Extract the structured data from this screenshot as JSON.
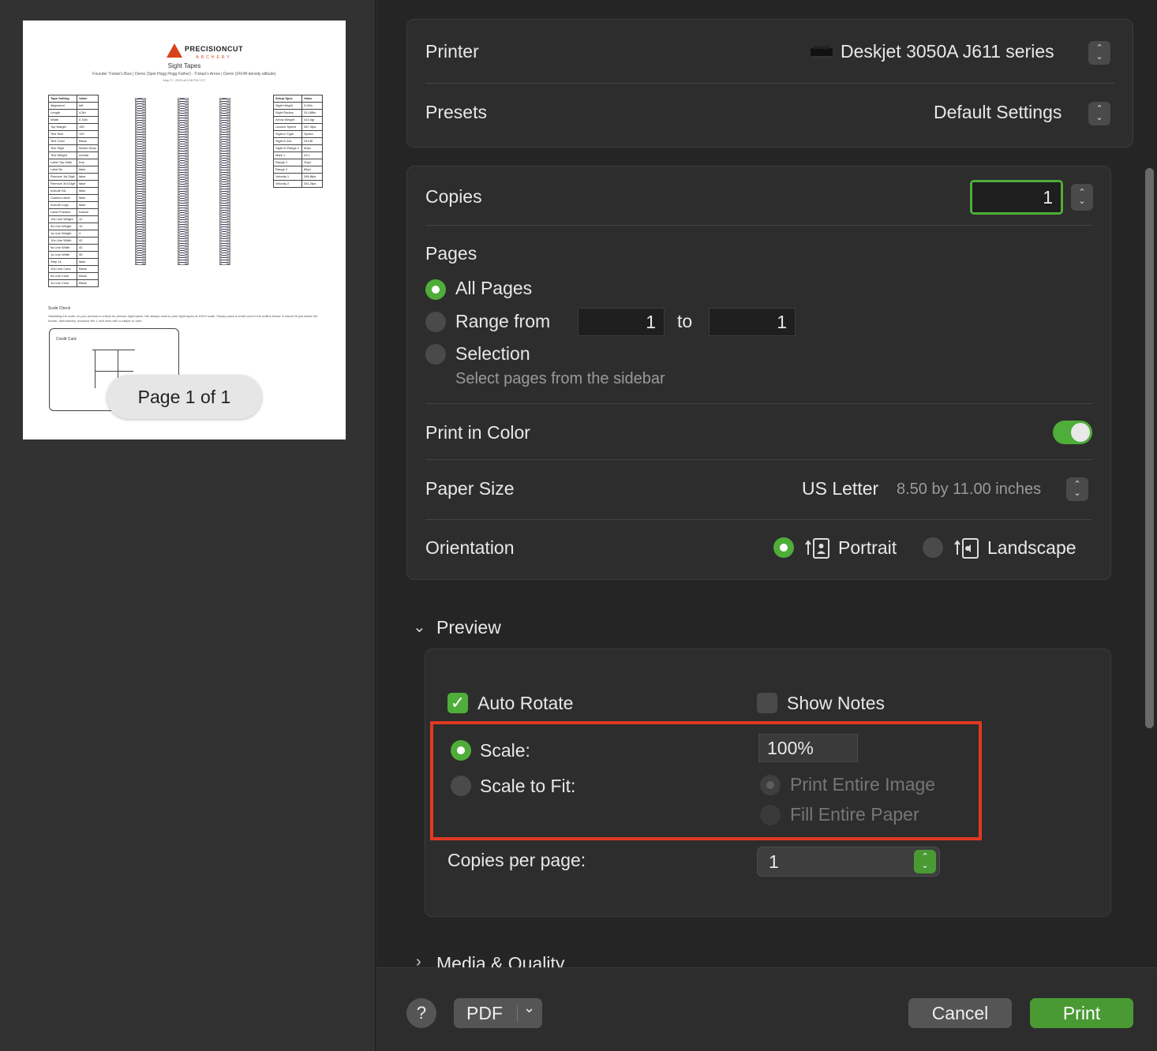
{
  "preview": {
    "logo_text": "PRECISIONCUT",
    "logo_sub": "ARCHERY",
    "doc_title": "Sight Tapes",
    "doc_subtitle": "Founder Tristan's Bow | Demo (Spot Hogg Hogg Father) - Tristan's Arrow | Demo (2414ft density altitude)",
    "doc_date": "May 27, 2025 at 8:38 PM CDT",
    "left_table": [
      [
        "Tape Setting",
        "Value"
      ],
      [
        "Alignment",
        "left"
      ],
      [
        "Length",
        "4.5in"
      ],
      [
        "Width",
        "0.15in"
      ],
      [
        "Top Margin",
        "150"
      ],
      [
        "Text Size",
        "120"
      ],
      [
        "Text Color",
        "Black"
      ],
      [
        "Text Style",
        "Nunito Sans"
      ],
      [
        "Text Weight",
        "normal"
      ],
      [
        "Label Top Mark",
        "true"
      ],
      [
        "Label 5s",
        "false"
      ],
      [
        "Remove 1st Digit",
        "false"
      ],
      [
        "Remove 3rd Digit",
        "false"
      ],
      [
        "Include DA",
        "false"
      ],
      [
        "Custom Label",
        "false"
      ],
      [
        "Include Logo",
        "false"
      ],
      [
        "Label Position",
        "bottom"
      ],
      [
        "10s Line Weight",
        "12"
      ],
      [
        "5s Line Weight",
        "10"
      ],
      [
        "1s Line Weight",
        "4"
      ],
      [
        "10s Line Width",
        "42"
      ],
      [
        "5s Line Width",
        "40"
      ],
      [
        "1s Line Width",
        "35"
      ],
      [
        "Step 1s",
        "false"
      ],
      [
        "10s Line Color",
        "Black"
      ],
      [
        "5s Line Color",
        "Black"
      ],
      [
        "1s Line Color",
        "Black"
      ]
    ],
    "right_table": [
      [
        "Setup Spec",
        "Value"
      ],
      [
        "Sight Height",
        "3.92in"
      ],
      [
        "Sight Radius",
        "25.188in"
      ],
      [
        "Arrow Weight",
        "413.4gr"
      ],
      [
        "Launch Speed",
        "287.4fps"
      ],
      [
        "Sight-in Type",
        "Speed"
      ],
      [
        "Sight-in DA",
        "2414ft"
      ],
      [
        "Sight-In Range 1",
        "60yd"
      ],
      [
        "Mark 1",
        "23.1"
      ],
      [
        "Range 1",
        "20yd"
      ],
      [
        "Range 2",
        "65yd"
      ],
      [
        "Velocity 1",
        "286.8fps"
      ],
      [
        "Velocity 2",
        "261.2fps"
      ]
    ],
    "scale_check_title": "Scale Check",
    "scale_check_text": "Validating the scale on your printout is critical for precise sight tapes. We always want to print sight tapes at 100% scale. Simply place a credit card in the outline below. It should fit just inside the border. Alternatively, measure the 1 inch lines with a caliper or ruler.",
    "card_label": "Credit Card",
    "page_indicator": "Page 1 of 1"
  },
  "printer": {
    "label": "Printer",
    "value": "Deskjet 3050A J611 series"
  },
  "presets": {
    "label": "Presets",
    "value": "Default Settings"
  },
  "copies": {
    "label": "Copies",
    "value": "1"
  },
  "pages": {
    "label": "Pages",
    "all_pages": "All Pages",
    "range_from": "Range from",
    "range_start": "1",
    "range_to": "to",
    "range_end": "1",
    "selection": "Selection",
    "selection_hint": "Select pages from the sidebar"
  },
  "print_in_color": {
    "label": "Print in Color",
    "enabled": true
  },
  "paper_size": {
    "label": "Paper Size",
    "value": "US Letter",
    "detail": "8.50 by 11.00 inches"
  },
  "orientation": {
    "label": "Orientation",
    "portrait": "Portrait",
    "landscape": "Landscape",
    "selected": "Portrait"
  },
  "preview_section": {
    "label": "Preview",
    "auto_rotate": "Auto Rotate",
    "show_notes": "Show Notes",
    "scale": "Scale:",
    "scale_value": "100%",
    "scale_to_fit": "Scale to Fit:",
    "print_entire_image": "Print Entire Image",
    "fill_entire_paper": "Fill Entire Paper",
    "copies_per_page": "Copies per page:",
    "copies_per_page_value": "1"
  },
  "media_quality": {
    "label": "Media & Quality"
  },
  "footer": {
    "help": "?",
    "pdf": "PDF",
    "cancel": "Cancel",
    "print": "Print"
  },
  "colors": {
    "accent_green": "#4fad3a",
    "highlight_red": "#e03a22"
  }
}
